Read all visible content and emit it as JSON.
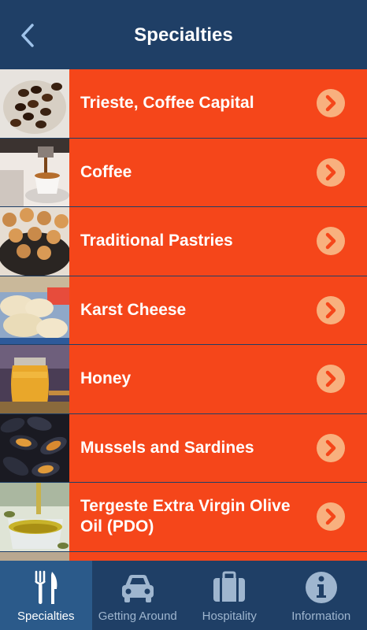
{
  "header": {
    "title": "Specialties",
    "back_icon": "chevron-left-icon"
  },
  "items": [
    {
      "label": "Trieste, Coffee Capital",
      "thumb": "coffee-beans-photo"
    },
    {
      "label": "Coffee",
      "thumb": "espresso-cup-photo"
    },
    {
      "label": "Traditional Pastries",
      "thumb": "pastries-photo"
    },
    {
      "label": "Karst Cheese",
      "thumb": "cheese-photo"
    },
    {
      "label": "Honey",
      "thumb": "honey-jar-photo"
    },
    {
      "label": "Mussels and Sardines",
      "thumb": "mussels-photo"
    },
    {
      "label": "Tergeste Extra Virgin Olive Oil (PDO)",
      "thumb": "olive-oil-photo"
    }
  ],
  "tabs": [
    {
      "label": "Specialties",
      "icon": "fork-knife-icon",
      "active": true
    },
    {
      "label": "Getting Around",
      "icon": "car-icon",
      "active": false
    },
    {
      "label": "Hospitality",
      "icon": "suitcase-icon",
      "active": false
    },
    {
      "label": "Information",
      "icon": "info-icon",
      "active": false
    }
  ],
  "colors": {
    "header": "#1f3f66",
    "row": "#f5461a",
    "chevron_circle": "#f8b07e",
    "tab_active": "#2b5a8a"
  }
}
